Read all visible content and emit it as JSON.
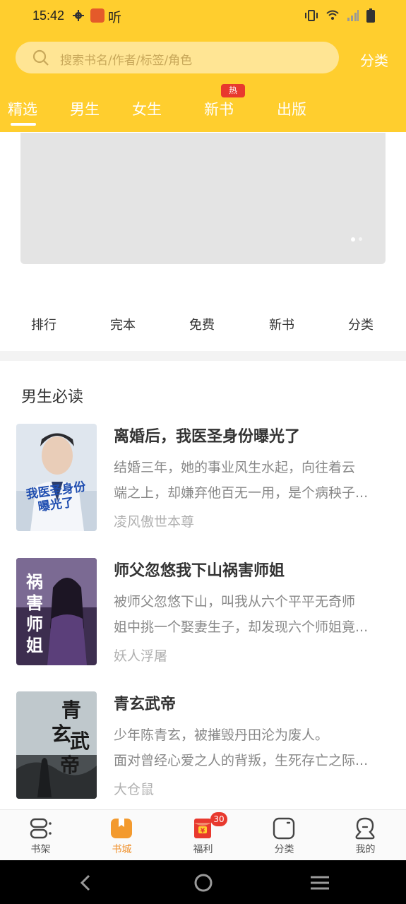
{
  "status_bar": {
    "time": "15:42",
    "app_label": "听"
  },
  "search": {
    "placeholder": "搜索书名/作者/标签/角色"
  },
  "header": {
    "category_link": "分类",
    "tabs": [
      {
        "label": "精选",
        "active": true
      },
      {
        "label": "男生",
        "active": false
      },
      {
        "label": "女生",
        "active": false
      },
      {
        "label": "新书",
        "active": false,
        "badge": "热"
      },
      {
        "label": "出版",
        "active": false
      }
    ]
  },
  "banner": {
    "page_count": 2,
    "current_page": 1
  },
  "quick_nav": [
    "排行",
    "完本",
    "免费",
    "新书",
    "分类"
  ],
  "section": {
    "title": "男生必读",
    "books": [
      {
        "title": "离婚后，我医圣身份曝光了",
        "desc_line1": "结婚三年，她的事业风生水起，向往着云",
        "desc_line2": "端之上，却嫌弃他百无一用，是个病秧子...",
        "author": "凌风傲世本尊"
      },
      {
        "title": "师父忽悠我下山祸害师姐",
        "desc_line1": "被师父忽悠下山，叫我从六个平平无奇师",
        "desc_line2": "姐中挑一个娶妻生子，却发现六个师姐竟...",
        "author": "妖人浮屠"
      },
      {
        "title": "青玄武帝",
        "desc_line1": "少年陈青玄，被摧毁丹田沦为废人。",
        "desc_line2": "面对曾经心爱之人的背叛，生死存亡之际...",
        "author": "大仓鼠"
      }
    ]
  },
  "bottom_nav": {
    "items": [
      {
        "label": "书架",
        "icon": "bookshelf-icon",
        "active": false
      },
      {
        "label": "书城",
        "icon": "bookstore-icon",
        "active": true
      },
      {
        "label": "福利",
        "icon": "red-envelope-icon",
        "active": false,
        "badge": "30"
      },
      {
        "label": "分类",
        "icon": "category-icon",
        "active": false
      },
      {
        "label": "我的",
        "icon": "profile-icon",
        "active": false
      }
    ]
  },
  "colors": {
    "brand_yellow": "#FFCE2E",
    "accent_orange": "#F0922E",
    "badge_red": "#E8392E"
  }
}
